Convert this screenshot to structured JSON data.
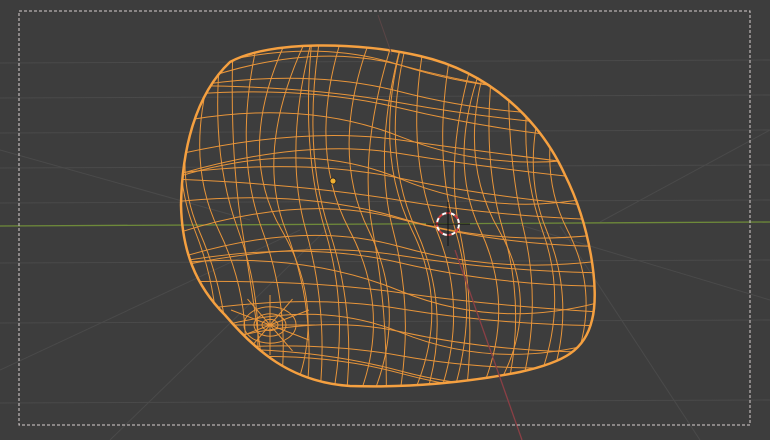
{
  "viewport": {
    "mode": "wireframe",
    "colors": {
      "background": "#3d3d3d",
      "grid": "#4a4a4a",
      "x_axis": "#6e8a3a",
      "y_axis": "#8a3f45",
      "wire_selected": "#e8953a",
      "outline_selected": "#f5a040",
      "origin": "#f0b030",
      "camera_frame": "#d8d0d0"
    },
    "icons": [
      "3d-cursor-icon",
      "object-origin-icon"
    ]
  }
}
